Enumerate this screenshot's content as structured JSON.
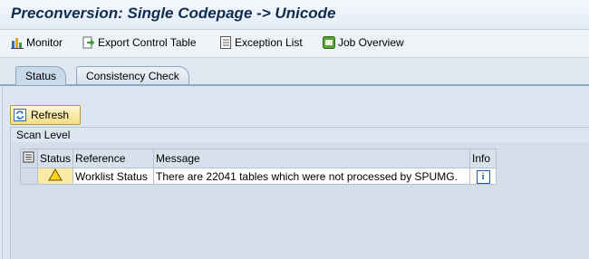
{
  "window": {
    "title": "Preconversion: Single Codepage -> Unicode"
  },
  "toolbar": {
    "items": [
      {
        "label": "Monitor",
        "icon": "monitor-icon"
      },
      {
        "label": "Export Control Table",
        "icon": "export-icon"
      },
      {
        "label": "Exception List",
        "icon": "list-icon"
      },
      {
        "label": "Job Overview",
        "icon": "job-icon"
      }
    ]
  },
  "tabs": [
    {
      "label": "Status",
      "active": true
    },
    {
      "label": "Consistency Check",
      "active": false
    }
  ],
  "refresh": {
    "label": "Refresh",
    "icon": "refresh-icon"
  },
  "scan_level": {
    "title": "Scan Level"
  },
  "table": {
    "columns": [
      "Status",
      "Reference",
      "Message",
      "Info"
    ],
    "rows": [
      {
        "status_icon": "warning-icon",
        "reference": "Worklist Status",
        "message": "There are 22041 tables which were not processed by SPUMG.",
        "info_icon": "info-icon"
      }
    ]
  },
  "colors": {
    "title": "#102c4f",
    "warning_bg": "#fbe9a6",
    "refresh_bg": "#f4dd84",
    "info_blue": "#1f5fa6"
  }
}
